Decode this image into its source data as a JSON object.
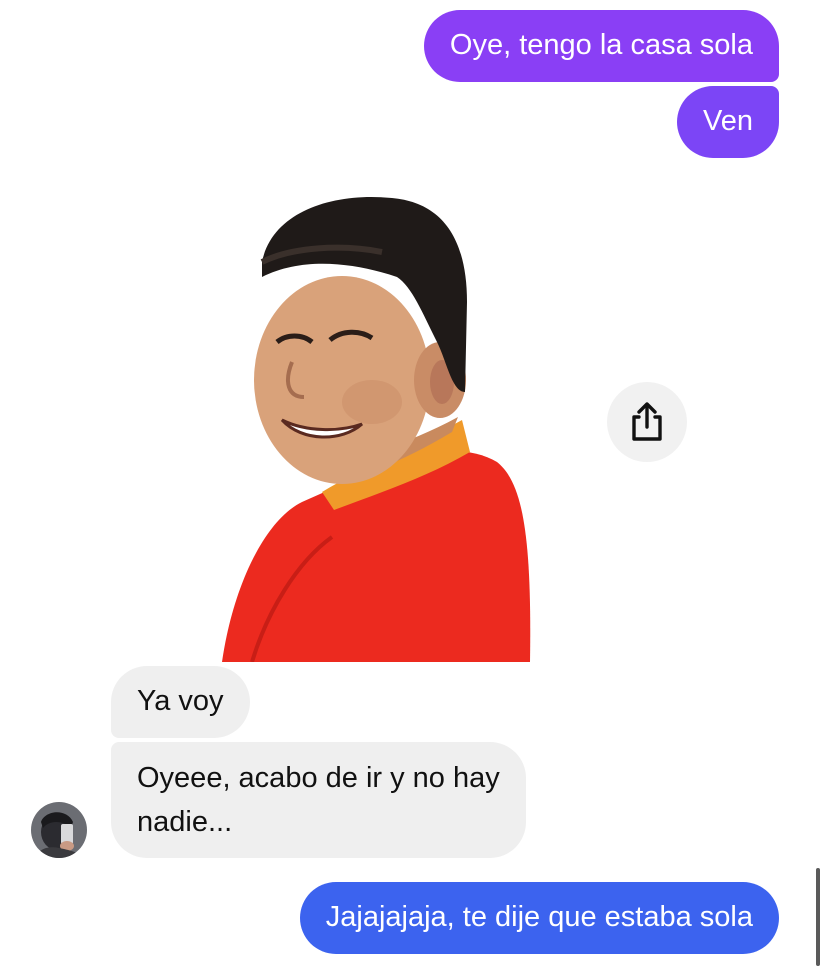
{
  "conversation": {
    "messages": [
      {
        "sender": "me",
        "text": "Oye, tengo la casa sola",
        "color": "#8a3ff5"
      },
      {
        "sender": "me",
        "text": "Ven",
        "color": "#7c45f6"
      },
      {
        "sender": "me",
        "type": "sticker"
      },
      {
        "sender": "other",
        "text": "Ya voy"
      },
      {
        "sender": "other",
        "text": "Oyeee, acabo de ir y no hay nadie..."
      },
      {
        "sender": "me",
        "text": "Jajajajaja, te dije que estaba sola",
        "color": "#3c63ef"
      }
    ]
  },
  "share_button": {
    "icon": "share-icon"
  },
  "colors": {
    "incoming_bubble": "#efefef",
    "background": "#ffffff"
  }
}
